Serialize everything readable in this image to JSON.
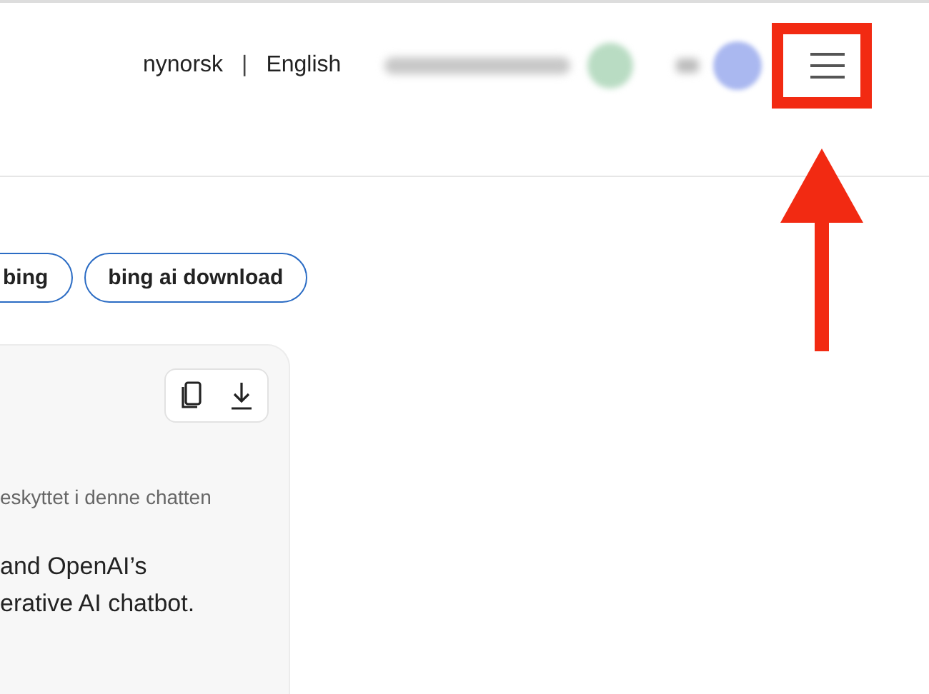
{
  "header": {
    "languages": [
      "nynorsk",
      "English"
    ],
    "separator": "|"
  },
  "chips": [
    "bing",
    "bing ai download"
  ],
  "card": {
    "notice": "eskyttet i denne chatten",
    "lines": [
      "and OpenAI’s",
      "erative AI chatbot."
    ]
  }
}
